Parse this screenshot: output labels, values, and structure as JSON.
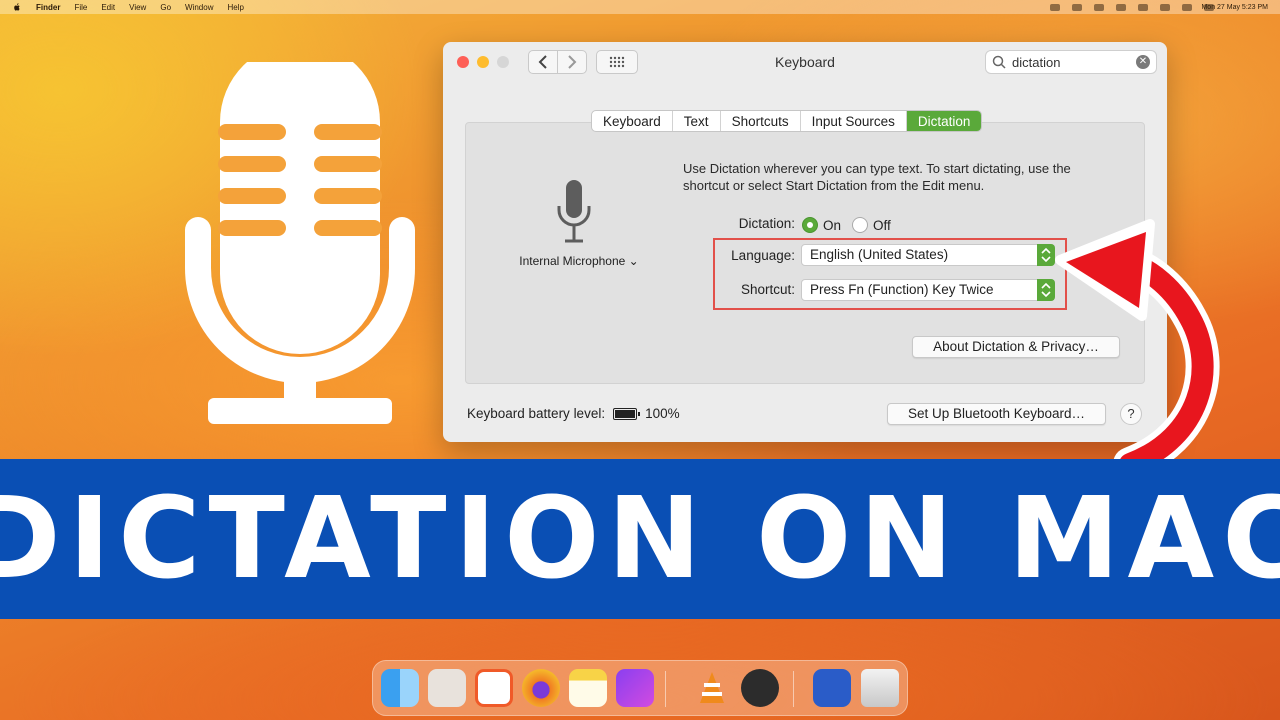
{
  "menubar": {
    "app": "Finder",
    "items": [
      "File",
      "Edit",
      "View",
      "Go",
      "Window",
      "Help"
    ],
    "clock": "Mon 27 May  5:23 PM"
  },
  "window": {
    "title": "Keyboard",
    "search": {
      "value": "dictation"
    },
    "tabs": [
      "Keyboard",
      "Text",
      "Shortcuts",
      "Input Sources",
      "Dictation"
    ],
    "active_tab": "Dictation",
    "description": "Use Dictation wherever you can type text. To start dictating, use the shortcut or select Start Dictation from the Edit menu.",
    "mic_source": "Internal Microphone ⌄",
    "dictation_label": "Dictation:",
    "dictation_on": "On",
    "dictation_off": "Off",
    "language_label": "Language:",
    "language_value": "English (United States)",
    "shortcut_label": "Shortcut:",
    "shortcut_value": "Press Fn (Function) Key Twice",
    "about_button": "About Dictation & Privacy…",
    "battery_label": "Keyboard battery level:",
    "battery_value": "100%",
    "bluetooth_button": "Set Up Bluetooth Keyboard…",
    "help": "?"
  },
  "banner": {
    "text": "DICTATION ON MAC"
  },
  "colors": {
    "accent_green": "#5aa93a",
    "banner_blue": "#0a4fb4",
    "highlight_red": "#e2504a",
    "arrow_red": "#e8161e"
  },
  "dock": {
    "icons": [
      "finder-icon",
      "launchpad-icon",
      "brave-icon",
      "firefox-icon",
      "notes-icon",
      "toolbox-icon",
      "vlc-icon",
      "quicktime-icon",
      "window-icon",
      "trash-icon"
    ]
  }
}
